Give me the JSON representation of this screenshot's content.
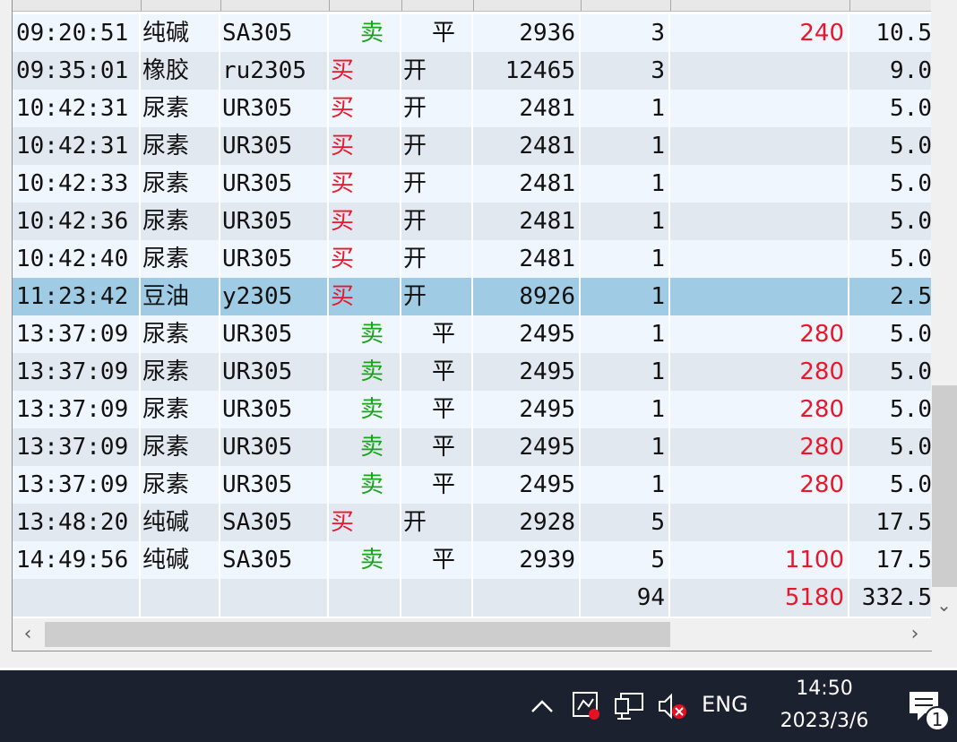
{
  "trades": [
    {
      "time": "09:20:51",
      "name": "纯碱",
      "code": "SA305",
      "dir": "卖",
      "dir_type": "sell",
      "oc": "平",
      "oc_type": "close",
      "price": "2936",
      "qty": "3",
      "pnl": "240",
      "fee": "10.5"
    },
    {
      "time": "09:35:01",
      "name": "橡胶",
      "code": "ru2305",
      "dir": "买",
      "dir_type": "buy",
      "oc": "开",
      "oc_type": "open",
      "price": "12465",
      "qty": "3",
      "pnl": "",
      "fee": "9.0"
    },
    {
      "time": "10:42:31",
      "name": "尿素",
      "code": "UR305",
      "dir": "买",
      "dir_type": "buy",
      "oc": "开",
      "oc_type": "open",
      "price": "2481",
      "qty": "1",
      "pnl": "",
      "fee": "5.0"
    },
    {
      "time": "10:42:31",
      "name": "尿素",
      "code": "UR305",
      "dir": "买",
      "dir_type": "buy",
      "oc": "开",
      "oc_type": "open",
      "price": "2481",
      "qty": "1",
      "pnl": "",
      "fee": "5.0"
    },
    {
      "time": "10:42:33",
      "name": "尿素",
      "code": "UR305",
      "dir": "买",
      "dir_type": "buy",
      "oc": "开",
      "oc_type": "open",
      "price": "2481",
      "qty": "1",
      "pnl": "",
      "fee": "5.0"
    },
    {
      "time": "10:42:36",
      "name": "尿素",
      "code": "UR305",
      "dir": "买",
      "dir_type": "buy",
      "oc": "开",
      "oc_type": "open",
      "price": "2481",
      "qty": "1",
      "pnl": "",
      "fee": "5.0"
    },
    {
      "time": "10:42:40",
      "name": "尿素",
      "code": "UR305",
      "dir": "买",
      "dir_type": "buy",
      "oc": "开",
      "oc_type": "open",
      "price": "2481",
      "qty": "1",
      "pnl": "",
      "fee": "5.0"
    },
    {
      "time": "11:23:42",
      "name": "豆油",
      "code": "y2305",
      "dir": "买",
      "dir_type": "buy",
      "oc": "开",
      "oc_type": "open",
      "price": "8926",
      "qty": "1",
      "pnl": "",
      "fee": "2.5",
      "selected": true
    },
    {
      "time": "13:37:09",
      "name": "尿素",
      "code": "UR305",
      "dir": "卖",
      "dir_type": "sell",
      "oc": "平",
      "oc_type": "close",
      "price": "2495",
      "qty": "1",
      "pnl": "280",
      "fee": "5.0"
    },
    {
      "time": "13:37:09",
      "name": "尿素",
      "code": "UR305",
      "dir": "卖",
      "dir_type": "sell",
      "oc": "平",
      "oc_type": "close",
      "price": "2495",
      "qty": "1",
      "pnl": "280",
      "fee": "5.0"
    },
    {
      "time": "13:37:09",
      "name": "尿素",
      "code": "UR305",
      "dir": "卖",
      "dir_type": "sell",
      "oc": "平",
      "oc_type": "close",
      "price": "2495",
      "qty": "1",
      "pnl": "280",
      "fee": "5.0"
    },
    {
      "time": "13:37:09",
      "name": "尿素",
      "code": "UR305",
      "dir": "卖",
      "dir_type": "sell",
      "oc": "平",
      "oc_type": "close",
      "price": "2495",
      "qty": "1",
      "pnl": "280",
      "fee": "5.0"
    },
    {
      "time": "13:37:09",
      "name": "尿素",
      "code": "UR305",
      "dir": "卖",
      "dir_type": "sell",
      "oc": "平",
      "oc_type": "close",
      "price": "2495",
      "qty": "1",
      "pnl": "280",
      "fee": "5.0"
    },
    {
      "time": "13:48:20",
      "name": "纯碱",
      "code": "SA305",
      "dir": "买",
      "dir_type": "buy",
      "oc": "开",
      "oc_type": "open",
      "price": "2928",
      "qty": "5",
      "pnl": "",
      "fee": "17.5"
    },
    {
      "time": "14:49:56",
      "name": "纯碱",
      "code": "SA305",
      "dir": "卖",
      "dir_type": "sell",
      "oc": "平",
      "oc_type": "close",
      "price": "2939",
      "qty": "5",
      "pnl": "1100",
      "fee": "17.5"
    }
  ],
  "totals": {
    "qty": "94",
    "pnl": "5180",
    "fee": "332.5"
  },
  "colors": {
    "buy": "#e8172b",
    "sell": "#1aa31a",
    "selected_row": "#9fcce4",
    "taskbar": "#1c2130"
  },
  "taskbar": {
    "language": "ENG",
    "time": "14:50",
    "date": "2023/3/6",
    "notification_count": "1"
  },
  "icons": {
    "tray_chevron": "chevron-up-icon",
    "app": "app-tray-icon",
    "network": "network-icon",
    "volume": "volume-muted-icon",
    "notifications": "notification-icon"
  }
}
